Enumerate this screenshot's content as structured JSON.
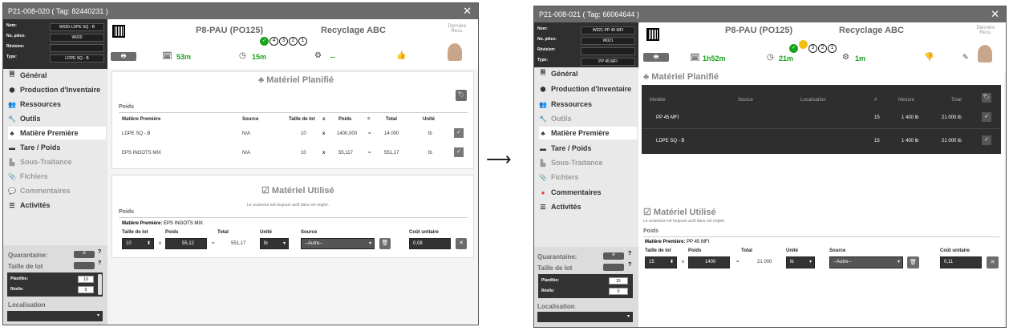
{
  "left": {
    "title": "P21-008-020 ( Tag: 82440231 )",
    "fields": {
      "nom_label": "Nom:",
      "nom": "W020-LDPE SQ - B",
      "piece_label": "No. pièce:",
      "piece": "W020",
      "revision_label": "Révision:",
      "revision": "",
      "type_label": "Type:",
      "type": "LDPE SQ - B"
    },
    "header": {
      "machine": "P8-PAU (PO125)",
      "company": "Recyclage ABC",
      "last": "Dernière",
      "ress": "Ress.",
      "steps": [
        "4",
        "3",
        "2",
        "1"
      ],
      "time1": "53m",
      "time2": "15m",
      "gears": "--"
    },
    "nav": [
      "Général",
      "Production d'Inventaire",
      "Ressources",
      "Outils",
      "Matière Première",
      "Tare / Poids",
      "Sous-Traitance",
      "Fichiers",
      "Commentaires",
      "Activités"
    ],
    "bottom": {
      "quarantine": "Quarantaine:",
      "lot": "Taille de lot",
      "planned": "Planifiée:",
      "planned_val": "10",
      "real": "Réelle:",
      "real_val": "0",
      "location": "Localisation"
    },
    "planned": {
      "title": "Matériel Planifié",
      "weights": "Poids",
      "cols": [
        "Matière Première",
        "Source",
        "Taille de lot",
        "x",
        "Poids",
        "=",
        "Total",
        "Unité"
      ],
      "rows": [
        [
          "LDPE SQ - B",
          "N/A",
          "10",
          "x",
          "1400,000",
          "=",
          "14 000",
          "lb"
        ],
        [
          "EPS INGOTS MIX",
          "N/A",
          "10",
          "x",
          "55,117",
          "=",
          "551,17",
          "lb"
        ]
      ]
    },
    "used": {
      "title": "Matériel Utilisé",
      "scanner": "Le scanneur est toujours actif dans cet onglet.",
      "weights": "Poids",
      "mp_label": "Matière Première:",
      "mp": "EPS INGOTS MIX",
      "lot_label": "Taille de lot",
      "poids_label": "Poids",
      "total_label": "Total",
      "unit_label": "Unité",
      "source_label": "Source",
      "cost_label": "Coût unitaire",
      "lot": "10",
      "poids": "55,12",
      "total": "551,17",
      "unit": "lb",
      "source": "--Autre--",
      "cost": "0,08",
      "x": "x",
      "eq": "="
    }
  },
  "right": {
    "title": "P21-008-021 ( Tag: 66064644 )",
    "fields": {
      "nom_label": "Nom:",
      "nom": "W021-PP 45 MFI",
      "piece_label": "No. pièce:",
      "piece": "W021",
      "revision_label": "Révision:",
      "revision": "",
      "type_label": "Type:",
      "type": "PP 45 MFI"
    },
    "header": {
      "machine": "P8-PAU (PO125)",
      "company": "Recyclage ABC",
      "last": "Dernière",
      "ress": "Ress.",
      "steps": [
        "3",
        "2",
        "1"
      ],
      "time1": "1h52m",
      "time2": "21m",
      "gears": "1m"
    },
    "nav": [
      "Général",
      "Production d'Inventaire",
      "Ressources",
      "Outils",
      "Matière Première",
      "Tare / Poids",
      "Sous-Traitance",
      "Fichiers",
      "Commentaires",
      "Activités"
    ],
    "bottom": {
      "quarantine": "Quarantaine:",
      "lot": "Taille de lot",
      "planned": "Planifiée:",
      "planned_val": "15",
      "real": "Réelle:",
      "real_val": "0",
      "location": "Localisation"
    },
    "planned": {
      "title": "Matériel Planifié",
      "cols": [
        "Modèle",
        "Source",
        "Localisation",
        "#",
        "Mesure",
        "Total"
      ],
      "rows": [
        [
          "PP 45 MFI",
          "",
          "",
          "15",
          "1 400 lb",
          "21 000 lb"
        ],
        [
          "LDPE SQ - B",
          "",
          "",
          "15",
          "1 400 lb",
          "21 000 lb"
        ]
      ]
    },
    "used": {
      "title": "Matériel Utilisé",
      "scanner": "Le scanneur est toujours actif dans cet onglet.",
      "weights": "Poids",
      "mp_label": "Matière Première:",
      "mp": "PP 45 MFI",
      "lot_label": "Taille de lot",
      "poids_label": "Poids",
      "total_label": "Total",
      "unit_label": "Unité",
      "source_label": "Source",
      "cost_label": "Coût unitaire",
      "lot": "15",
      "poids": "1400",
      "total": "21 000",
      "unit": "lb",
      "source": "--Autre--",
      "cost": "0,11",
      "x": "x",
      "eq": "="
    }
  },
  "arrow": "⟶",
  "colors": {
    "accent": "#1aa31a",
    "dark": "#333333",
    "title": "#6b6b6b",
    "red": "#e03b3b"
  }
}
